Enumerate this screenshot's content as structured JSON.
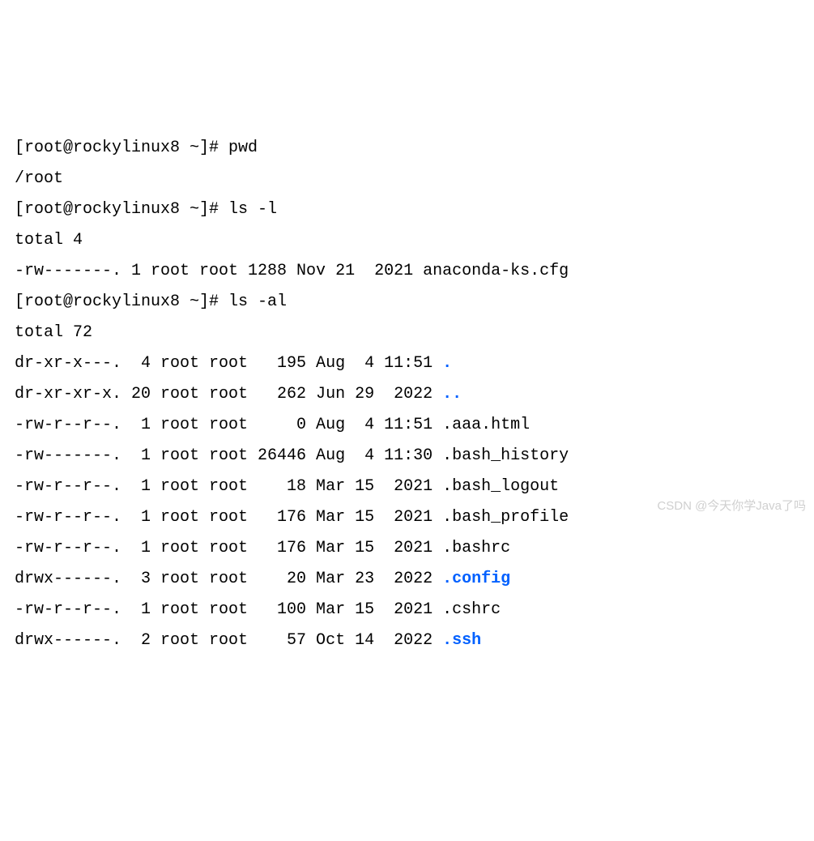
{
  "terminal": {
    "prompt": "[root@rockylinux8 ~]# ",
    "lines": [
      {
        "type": "cmd",
        "text": "pwd"
      },
      {
        "type": "out",
        "text": "/root"
      },
      {
        "type": "cmd",
        "text": "ls -l"
      },
      {
        "type": "out",
        "text": "total 4"
      },
      {
        "type": "out",
        "text": "-rw-------. 1 root root 1288 Nov 21  2021 anaconda-ks.cfg"
      },
      {
        "type": "cmd",
        "text": "ls -al"
      },
      {
        "type": "out",
        "text": "total 72"
      },
      {
        "type": "out",
        "pre": "dr-xr-x---.  4 root root   195 Aug  4 11:51 ",
        "colored": ".",
        "color": "blue"
      },
      {
        "type": "out",
        "pre": "dr-xr-xr-x. 20 root root   262 Jun 29  2022 ",
        "colored": "..",
        "color": "blue"
      },
      {
        "type": "out",
        "text": "-rw-r--r--.  1 root root     0 Aug  4 11:51 .aaa.html"
      },
      {
        "type": "out",
        "text": "-rw-------.  1 root root 26446 Aug  4 11:30 .bash_history"
      },
      {
        "type": "out",
        "text": "-rw-r--r--.  1 root root    18 Mar 15  2021 .bash_logout"
      },
      {
        "type": "out",
        "text": "-rw-r--r--.  1 root root   176 Mar 15  2021 .bash_profile"
      },
      {
        "type": "out",
        "text": "-rw-r--r--.  1 root root   176 Mar 15  2021 .bashrc"
      },
      {
        "type": "out",
        "pre": "drwx------.  3 root root    20 Mar 23  2022 ",
        "colored": ".config",
        "color": "blue"
      },
      {
        "type": "out",
        "text": "-rw-r--r--.  1 root root   100 Mar 15  2021 .cshrc"
      },
      {
        "type": "out",
        "pre": "drwx------.  2 root root    57 Oct 14  2022 ",
        "colored": ".ssh",
        "color": "blue",
        "partial": true
      }
    ]
  },
  "watermark": "CSDN @今天你学Java了吗"
}
